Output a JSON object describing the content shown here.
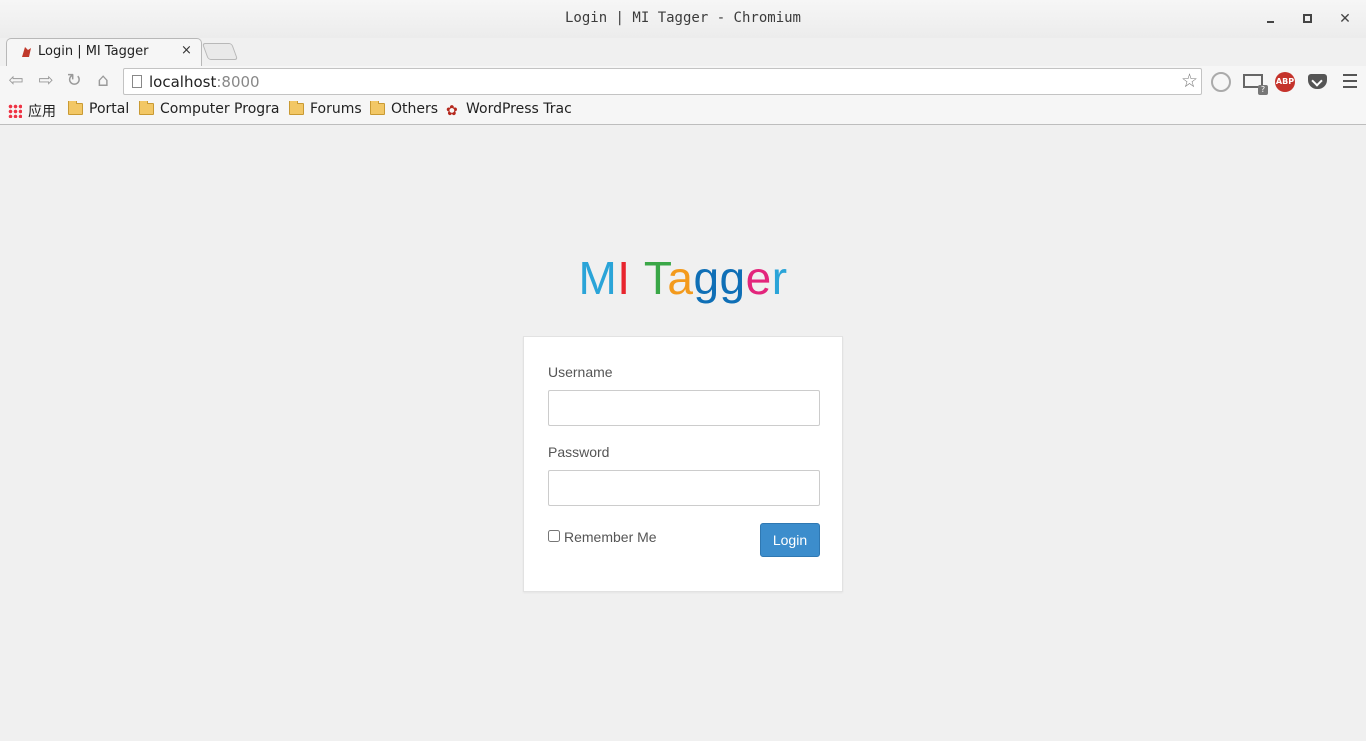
{
  "window": {
    "title": "Login | MI Tagger - Chromium"
  },
  "tab": {
    "label": "Login | MI Tagger",
    "close": "×"
  },
  "address_bar": {
    "host": "localhost",
    "port": ":8000"
  },
  "bookmarks": [
    {
      "label": "应用",
      "icon": "apps-icon"
    },
    {
      "label": "Portal",
      "icon": "folder-icon"
    },
    {
      "label": "Computer Program",
      "icon": "folder-icon"
    },
    {
      "label": "Forums",
      "icon": "folder-icon"
    },
    {
      "label": "Others",
      "icon": "folder-icon"
    },
    {
      "label": "WordPress Trac",
      "icon": "paw-icon"
    }
  ],
  "brand": {
    "letters": [
      {
        "ch": "M",
        "color": "#2aa4d8"
      },
      {
        "ch": "I",
        "color": "#e8252e"
      },
      {
        "ch": " ",
        "color": "#000000"
      },
      {
        "ch": "T",
        "color": "#3aa747"
      },
      {
        "ch": "a",
        "color": "#f39a1c"
      },
      {
        "ch": "g",
        "color": "#0f6fb6"
      },
      {
        "ch": "g",
        "color": "#0f6fb6"
      },
      {
        "ch": "e",
        "color": "#e3257c"
      },
      {
        "ch": "r",
        "color": "#2aa4d8"
      }
    ]
  },
  "form": {
    "username_label": "Username",
    "username_value": "",
    "password_label": "Password",
    "password_value": "",
    "remember_label": "Remember Me",
    "remember_checked": false,
    "login_button": "Login"
  }
}
